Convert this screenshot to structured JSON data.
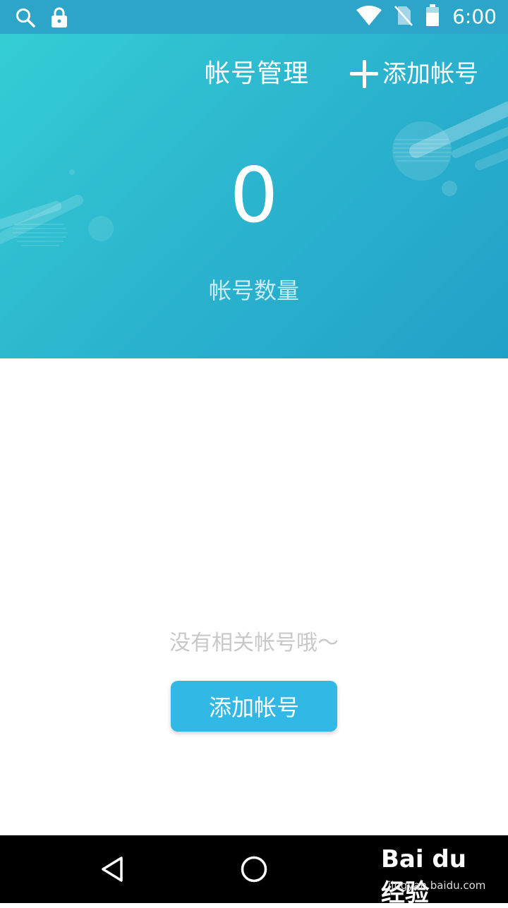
{
  "status_bar": {
    "time": "6:00",
    "icons": [
      "search-icon",
      "lock-icon",
      "wifi-icon",
      "no-sim-icon",
      "battery-icon"
    ]
  },
  "header": {
    "title": "帐号管理",
    "add_label": "添加帐号",
    "count": "0",
    "count_label": "帐号数量"
  },
  "empty_state": {
    "message": "没有相关帐号哦～",
    "button_label": "添加帐号"
  },
  "nav_bar": {
    "icons": [
      "back-icon",
      "home-icon"
    ]
  },
  "watermark": {
    "logo": "Bai du 经验",
    "url": "jingyan.baidu.com"
  },
  "colors": {
    "status_bar": "#2da5c9",
    "header_gradient_start": "#35cdd4",
    "header_gradient_end": "#22a1c8",
    "button": "#31b8e5"
  }
}
